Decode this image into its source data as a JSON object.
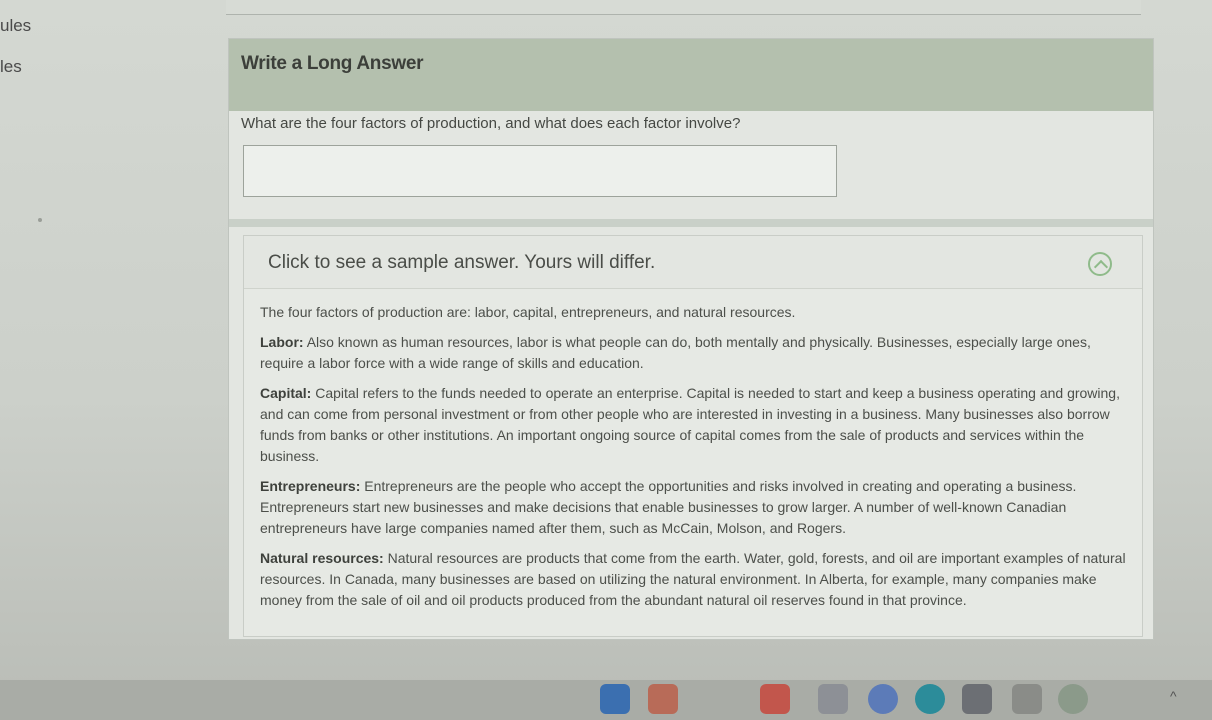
{
  "sidebar": {
    "items": [
      {
        "label": "ules"
      },
      {
        "label": "les"
      }
    ]
  },
  "card": {
    "title": "Write a Long Answer",
    "question": "What are the four factors of production, and what does each factor involve?",
    "answer_value": "",
    "sample": {
      "toggle_label": "Click to see a sample answer. Yours will differ.",
      "intro": "The four factors of production are: labor, capital, entrepreneurs, and natural resources.",
      "sections": [
        {
          "heading": "Labor:",
          "text": "Also known as human resources, labor is what people can do, both mentally and physically. Businesses, especially large ones, require a labor force with a wide range of skills and education."
        },
        {
          "heading": "Capital:",
          "text": "Capital refers to the funds needed to operate an enterprise. Capital is needed to start and keep a business operating and growing, and can come from personal investment or from other people who are interested in investing in a business. Many businesses also borrow funds from banks or other institutions. An important ongoing source of capital comes from the sale of products and services within the business."
        },
        {
          "heading": "Entrepreneurs:",
          "text": "Entrepreneurs are the people who accept the opportunities and risks involved in creating and operating a business. Entrepreneurs start new businesses and make decisions that enable businesses to grow larger. A number of well-known Canadian entrepreneurs have large companies named after them, such as McCain, Molson, and Rogers."
        },
        {
          "heading": "Natural resources:",
          "text": "Natural resources are products that come from the earth. Water, gold, forests, and oil are important examples of natural resources. In Canada, many businesses are based on utilizing the natural environment. In Alberta, for example, many companies make money from the sale of oil and oil products produced from the abundant natural oil reserves found in that province."
        }
      ]
    }
  },
  "taskbar": {
    "icons": [
      "windows-icon",
      "folder-icon",
      "chrome-icon",
      "word-icon",
      "app-icon",
      "edge-icon",
      "star-icon",
      "photo-icon",
      "settings-icon"
    ],
    "caret": "^"
  }
}
